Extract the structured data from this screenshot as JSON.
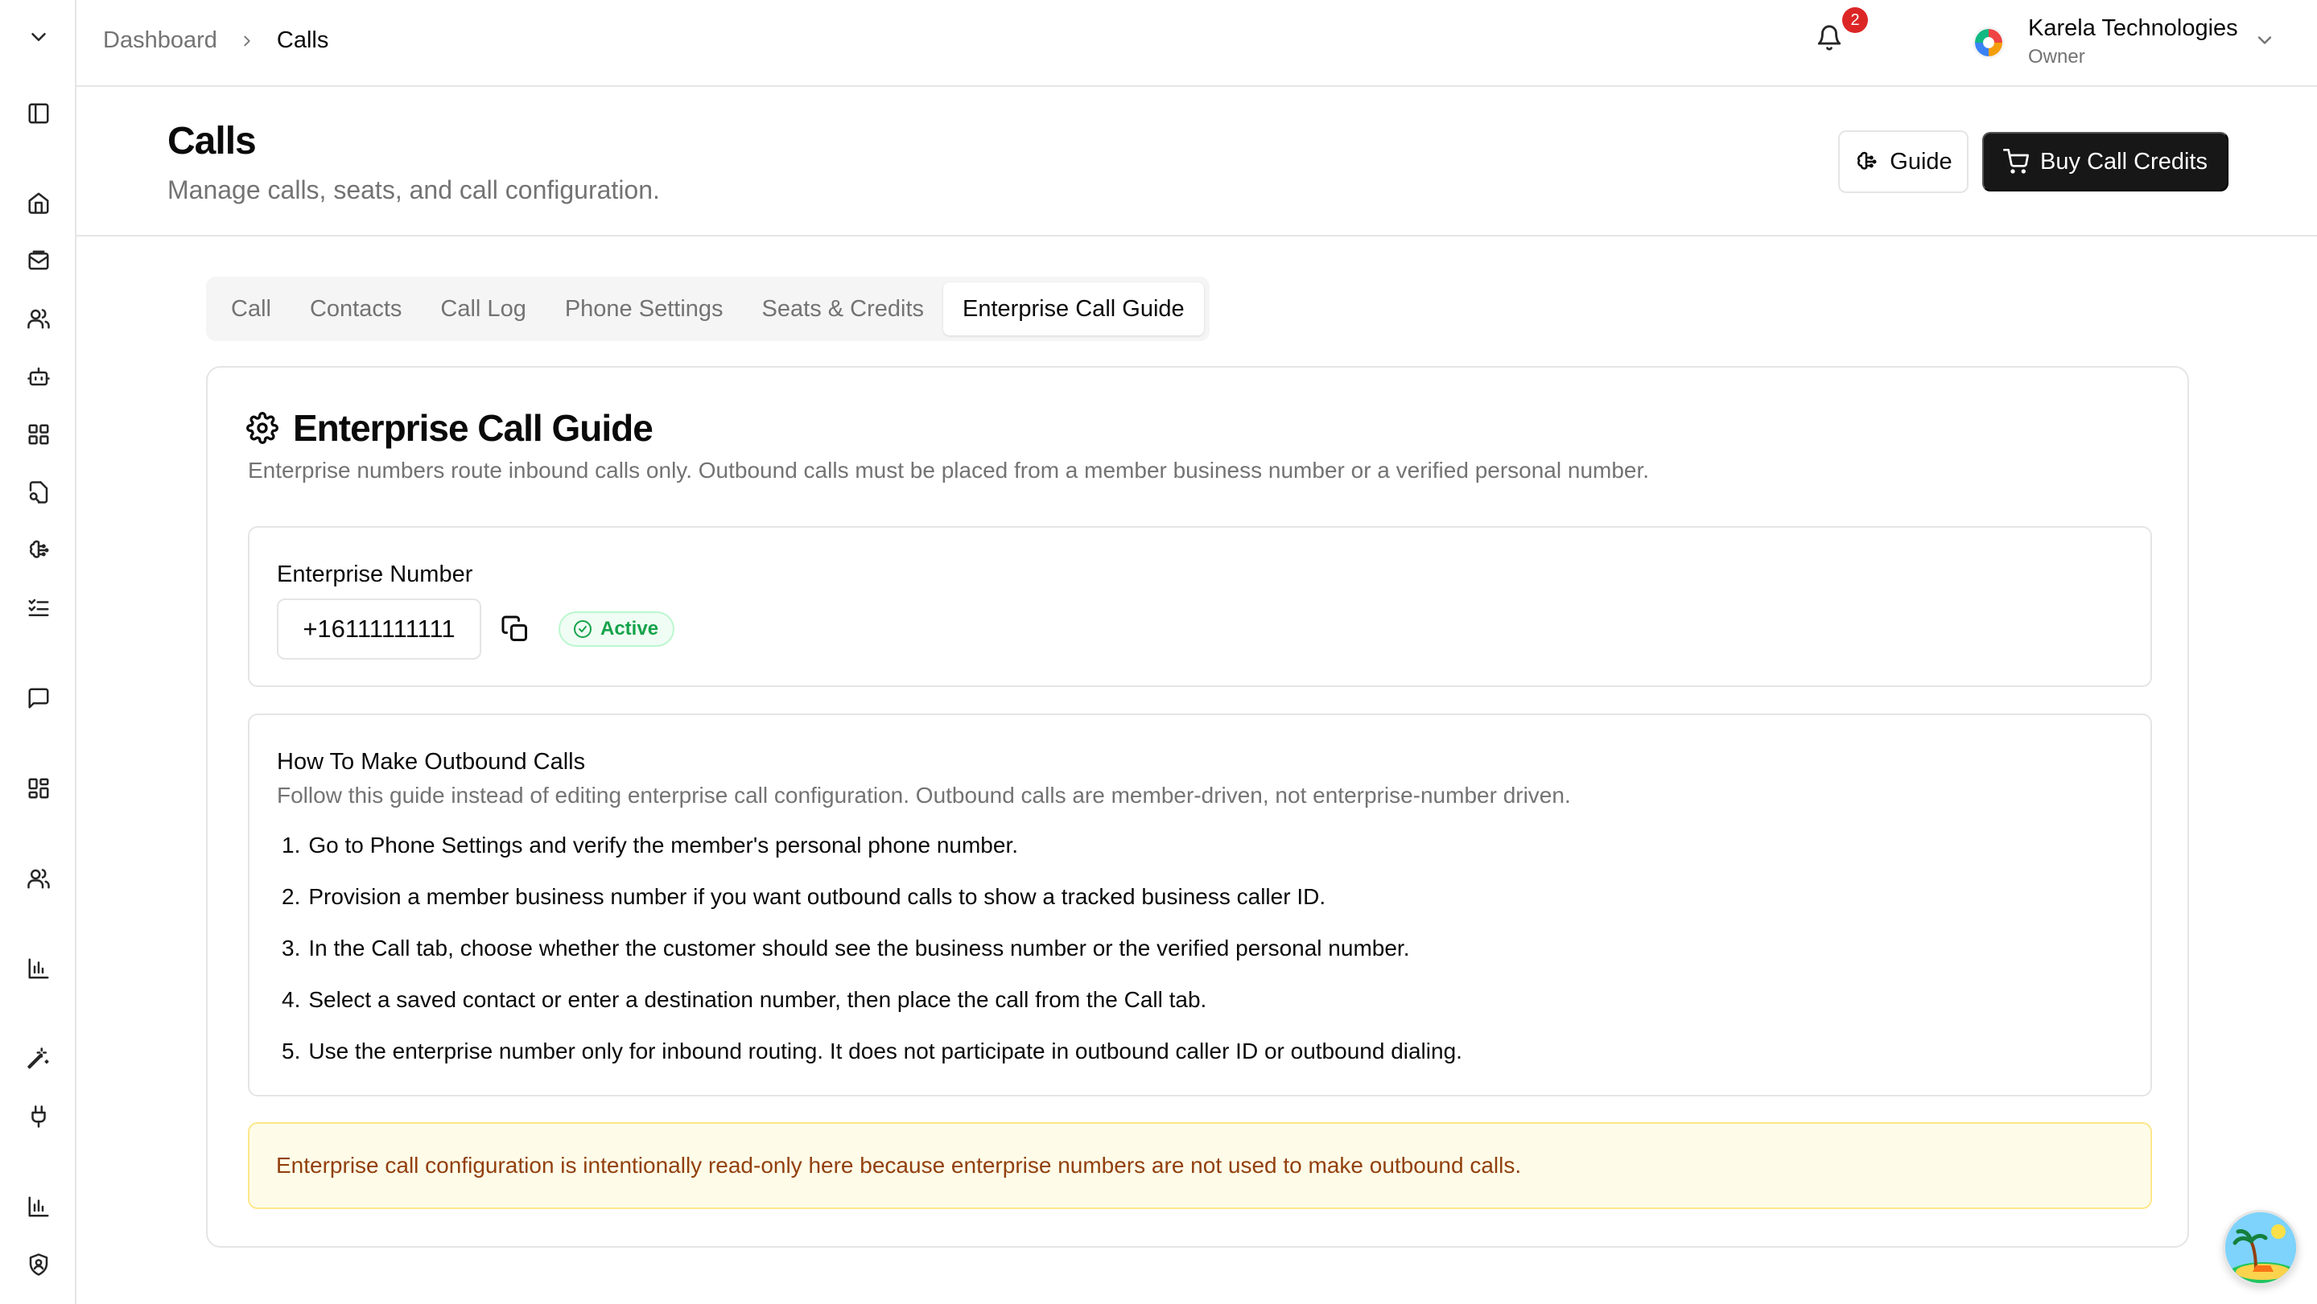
{
  "breadcrumb": {
    "parent": "Dashboard",
    "current": "Calls"
  },
  "notifications": {
    "count": "2"
  },
  "org": {
    "name": "Karela Technologies",
    "role": "Owner"
  },
  "page": {
    "title": "Calls",
    "subtitle": "Manage calls, seats, and call configuration.",
    "guide_label": "Guide",
    "buy_label": "Buy Call Credits"
  },
  "tabs": [
    {
      "label": "Call",
      "active": false
    },
    {
      "label": "Contacts",
      "active": false
    },
    {
      "label": "Call Log",
      "active": false
    },
    {
      "label": "Phone Settings",
      "active": false
    },
    {
      "label": "Seats & Credits",
      "active": false
    },
    {
      "label": "Enterprise Call Guide",
      "active": true
    }
  ],
  "guide": {
    "title": "Enterprise Call Guide",
    "description": "Enterprise numbers route inbound calls only. Outbound calls must be placed from a member business number or a verified personal number.",
    "enterprise_label": "Enterprise Number",
    "enterprise_number": "+16111111111",
    "status": "Active",
    "how_title": "How To Make Outbound Calls",
    "how_desc": "Follow this guide instead of editing enterprise call configuration. Outbound calls are member-driven, not enterprise-number driven.",
    "steps": [
      {
        "num": "1.",
        "text": "Go to Phone Settings and verify the member's personal phone number."
      },
      {
        "num": "2.",
        "text": "Provision a member business number if you want outbound calls to show a tracked business caller ID."
      },
      {
        "num": "3.",
        "text": "In the Call tab, choose whether the customer should see the business number or the verified personal number."
      },
      {
        "num": "4.",
        "text": "Select a saved contact or enter a destination number, then place the call from the Call tab."
      },
      {
        "num": "5.",
        "text": "Use the enterprise number only for inbound routing. It does not participate in outbound caller ID or outbound dialing."
      }
    ],
    "notice": "Enterprise call configuration is intentionally read-only here because enterprise numbers are not used to make outbound calls."
  },
  "colors": {
    "primary": "#171717",
    "active_green": "#16a34a",
    "notice_bg": "#fefce8",
    "badge_red": "#dc2626"
  },
  "sidebar_icons": [
    "chevron-down-icon",
    "panel-left-icon",
    "home-icon",
    "inbox-icon",
    "users-icon",
    "bot-icon",
    "grid-icon",
    "file-search-icon",
    "brain-icon",
    "list-checks-icon",
    "message-icon",
    "layout-icon",
    "contacts-icon",
    "chart-icon",
    "wand-icon",
    "plug-icon",
    "analytics-icon",
    "shield-icon"
  ]
}
